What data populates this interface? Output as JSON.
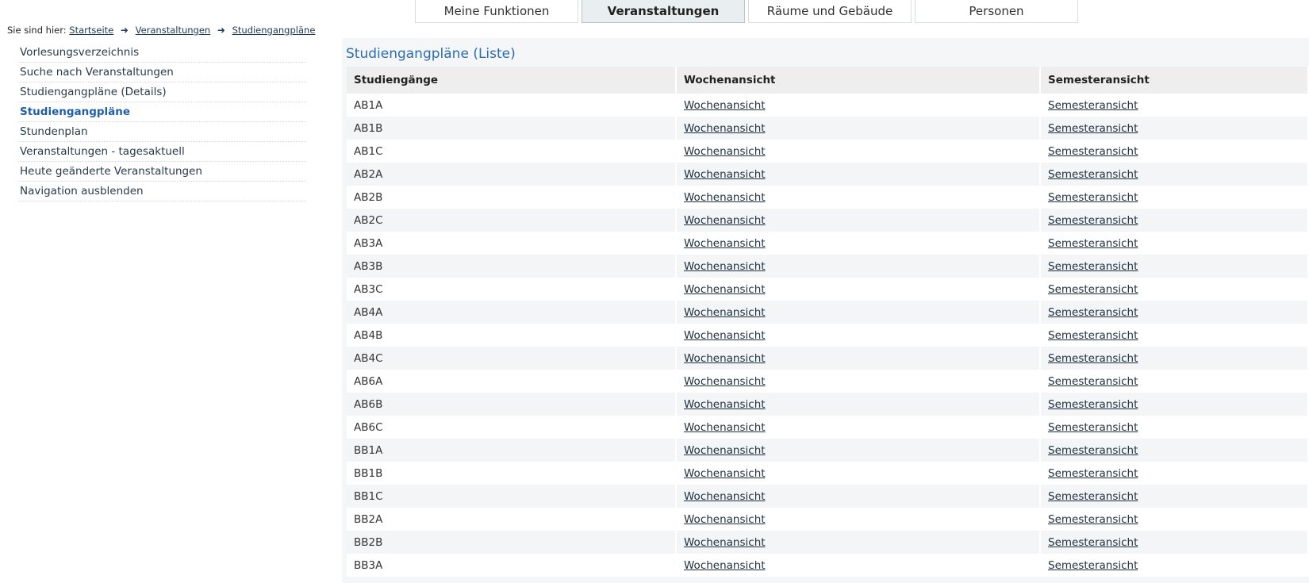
{
  "tabs": [
    {
      "label": "Meine Funktionen",
      "active": false
    },
    {
      "label": "Veranstaltungen",
      "active": true
    },
    {
      "label": "Räume und Gebäude",
      "active": false
    },
    {
      "label": "Personen",
      "active": false
    }
  ],
  "breadcrumb": {
    "prefix": "Sie sind hier:",
    "items": [
      "Startseite",
      "Veranstaltungen",
      "Studiengangpläne"
    ]
  },
  "sidebar": {
    "items": [
      {
        "label": "Vorlesungsverzeichnis",
        "active": false
      },
      {
        "label": "Suche nach Veranstaltungen",
        "active": false
      },
      {
        "label": "Studiengangpläne (Details)",
        "active": false
      },
      {
        "label": "Studiengangpläne",
        "active": true
      },
      {
        "label": "Stundenplan",
        "active": false
      },
      {
        "label": "Veranstaltungen - tagesaktuell",
        "active": false
      },
      {
        "label": "Heute geänderte Veranstaltungen",
        "active": false
      },
      {
        "label": "Navigation ausblenden",
        "active": false
      }
    ]
  },
  "main": {
    "title": "Studiengangpläne (Liste)",
    "columns": [
      "Studiengänge",
      "Wochenansicht",
      "Semesteransicht"
    ],
    "rows": [
      {
        "program": "AB1A",
        "week": "Wochenansicht",
        "semester": "Semesteransicht"
      },
      {
        "program": "AB1B",
        "week": "Wochenansicht",
        "semester": "Semesteransicht"
      },
      {
        "program": "AB1C",
        "week": "Wochenansicht",
        "semester": "Semesteransicht"
      },
      {
        "program": "AB2A",
        "week": "Wochenansicht",
        "semester": "Semesteransicht"
      },
      {
        "program": "AB2B",
        "week": "Wochenansicht",
        "semester": "Semesteransicht"
      },
      {
        "program": "AB2C",
        "week": "Wochenansicht",
        "semester": "Semesteransicht"
      },
      {
        "program": "AB3A",
        "week": "Wochenansicht",
        "semester": "Semesteransicht"
      },
      {
        "program": "AB3B",
        "week": "Wochenansicht",
        "semester": "Semesteransicht"
      },
      {
        "program": "AB3C",
        "week": "Wochenansicht",
        "semester": "Semesteransicht"
      },
      {
        "program": "AB4A",
        "week": "Wochenansicht",
        "semester": "Semesteransicht"
      },
      {
        "program": "AB4B",
        "week": "Wochenansicht",
        "semester": "Semesteransicht"
      },
      {
        "program": "AB4C",
        "week": "Wochenansicht",
        "semester": "Semesteransicht"
      },
      {
        "program": "AB6A",
        "week": "Wochenansicht",
        "semester": "Semesteransicht"
      },
      {
        "program": "AB6B",
        "week": "Wochenansicht",
        "semester": "Semesteransicht"
      },
      {
        "program": "AB6C",
        "week": "Wochenansicht",
        "semester": "Semesteransicht"
      },
      {
        "program": "BB1A",
        "week": "Wochenansicht",
        "semester": "Semesteransicht"
      },
      {
        "program": "BB1B",
        "week": "Wochenansicht",
        "semester": "Semesteransicht"
      },
      {
        "program": "BB1C",
        "week": "Wochenansicht",
        "semester": "Semesteransicht"
      },
      {
        "program": "BB2A",
        "week": "Wochenansicht",
        "semester": "Semesteransicht"
      },
      {
        "program": "BB2B",
        "week": "Wochenansicht",
        "semester": "Semesteransicht"
      },
      {
        "program": "BB3A",
        "week": "Wochenansicht",
        "semester": "Semesteransicht"
      }
    ]
  },
  "colors": {
    "accent": "#2c6db1",
    "active_nav": "#1f5ea8",
    "stripe": "#f3f5f6"
  },
  "icons": {
    "breadcrumb_separator": "arrow-right-icon"
  }
}
